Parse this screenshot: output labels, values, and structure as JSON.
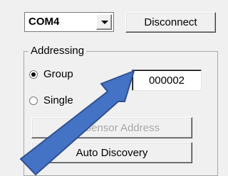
{
  "port_select": {
    "value": "COM4",
    "icon": "chevron-down-icon"
  },
  "buttons": {
    "disconnect": "Disconnect",
    "get_address": "Get Sensor Address",
    "auto_discovery": "Auto Discovery"
  },
  "addressing": {
    "title": "Addressing",
    "group_label": "Group",
    "single_label": "Single",
    "selected": "Group",
    "address_value": "000002"
  },
  "overlay": {
    "arrow_icon": "arrow-icon",
    "arrow_color": "#4472c4",
    "arrow_outline": "#2f528f"
  },
  "colors": {
    "panel": "#f0f0f0",
    "disabled_text": "#a0a0a0"
  }
}
